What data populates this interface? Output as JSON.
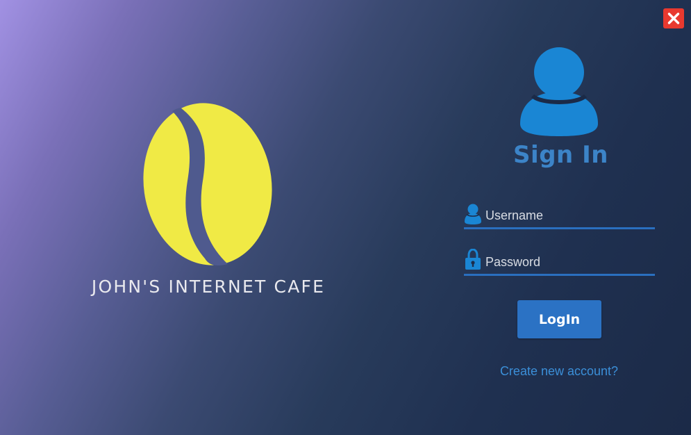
{
  "window": {
    "close_icon": "close-icon"
  },
  "branding": {
    "logo_icon": "coffee-bean-icon",
    "name": "JOHN'S INTERNET CAFE"
  },
  "signin": {
    "avatar_icon": "user-icon",
    "title": "Sign In",
    "username": {
      "icon": "user-icon",
      "placeholder": "Username",
      "value": ""
    },
    "password": {
      "icon": "lock-icon",
      "placeholder": "Password",
      "value": ""
    },
    "login_label": "LogIn",
    "create_account_label": "Create new account?"
  },
  "colors": {
    "accent": "#2b72c4",
    "title": "#3c84c8",
    "link": "#3b8fd8",
    "bean": "#f0ea45",
    "close": "#e8392f"
  }
}
